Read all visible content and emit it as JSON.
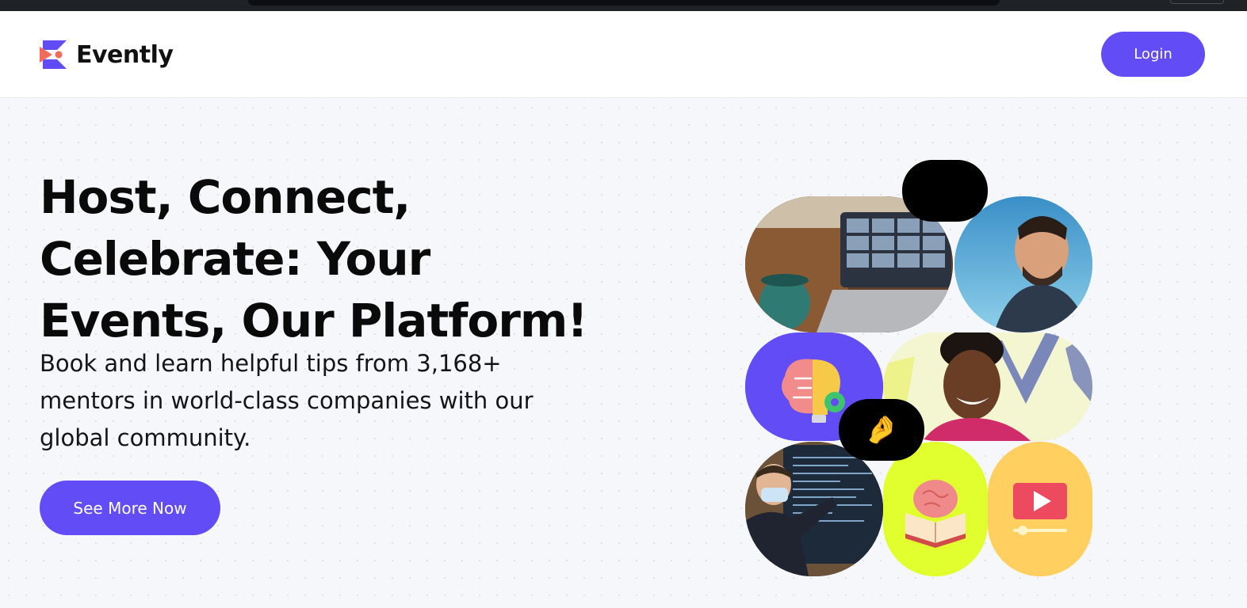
{
  "brand": {
    "name": "Evently",
    "primary_color": "#624cf5",
    "accent_color": "#f26b5b"
  },
  "nav": {
    "login_label": "Login"
  },
  "hero": {
    "headline": "Host, Connect, Celebrate: Your Events, Our Platform!",
    "subtext": "Book and learn helpful tips from 3,168+ mentors in world-class companies with our global community.",
    "cta_label": "See More Now"
  },
  "collage": {
    "bubble_top_emoji": "😍",
    "bubble_bottom_emoji": "🤌",
    "tiles": [
      {
        "name": "laptop-video-call-photo",
        "bg": "#6b4b32"
      },
      {
        "name": "smiling-man-photo",
        "bg": "#4aa8d8"
      },
      {
        "name": "brain-lightbulb-icon",
        "bg": "#624cf5"
      },
      {
        "name": "smiling-woman-photo",
        "bg": "#f2f3c8"
      },
      {
        "name": "presenter-photo",
        "bg": "#2a2f3a"
      },
      {
        "name": "brain-book-icon",
        "bg": "#e1ff2e"
      },
      {
        "name": "video-play-icon",
        "bg": "#ffd060"
      }
    ]
  }
}
